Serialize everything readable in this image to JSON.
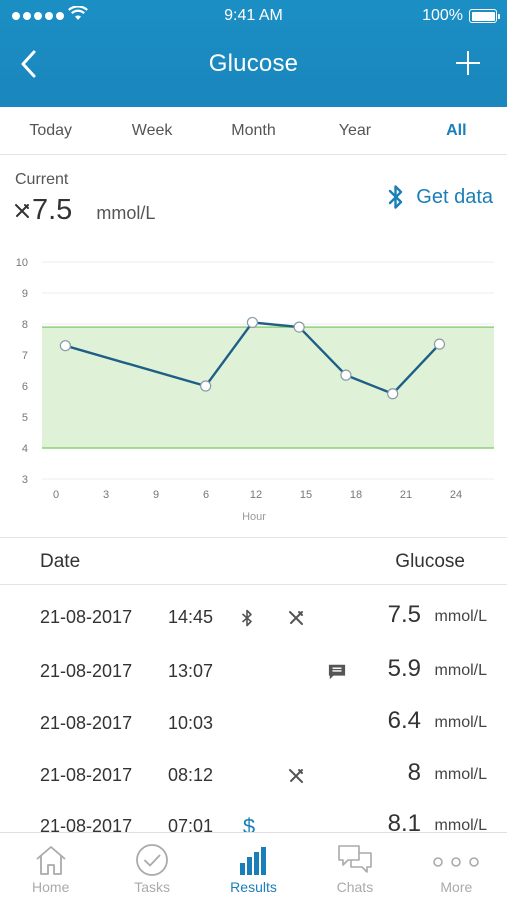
{
  "status_bar": {
    "time": "9:41 AM",
    "battery": "100%"
  },
  "nav": {
    "title": "Glucose"
  },
  "tabs": [
    {
      "label": "Today",
      "active": false
    },
    {
      "label": "Week",
      "active": false
    },
    {
      "label": "Month",
      "active": false
    },
    {
      "label": "Year",
      "active": false
    },
    {
      "label": "All",
      "active": true
    }
  ],
  "current": {
    "label": "Current",
    "value": "7.5",
    "unit": "mmol/L",
    "icon": "fork-knife-icon"
  },
  "get_data": {
    "label": "Get data",
    "icon": "bluetooth-icon"
  },
  "chart_data": {
    "type": "line",
    "xlabel": "Hour",
    "ylabel": "",
    "xlim": [
      -1.5,
      27.5
    ],
    "ylim": [
      3,
      10
    ],
    "x_ticks": [
      0,
      3,
      9,
      6,
      12,
      15,
      18,
      21,
      24
    ],
    "y_ticks": [
      10,
      9,
      8,
      7,
      6,
      5,
      4,
      3
    ],
    "target_range": [
      4,
      7.9
    ],
    "series": [
      {
        "x": [
          0,
          9,
          12,
          15,
          18,
          21,
          24
        ],
        "values": [
          7.3,
          6.0,
          8.05,
          7.9,
          6.35,
          5.75,
          7.35
        ]
      }
    ],
    "grid": true,
    "colors": {
      "line": "#1f5f87",
      "band": "#dff2d8",
      "band_border": "#8fd07c"
    }
  },
  "table": {
    "header": {
      "date": "Date",
      "glucose": "Glucose"
    },
    "rows": [
      {
        "date": "21-08-2017",
        "time": "14:45",
        "icons": [
          "bluetooth-icon",
          "fork-knife-icon"
        ],
        "value": "7.5",
        "unit": "mmol/L"
      },
      {
        "date": "21-08-2017",
        "time": "13:07",
        "icons": [
          "comment-icon"
        ],
        "value": "5.9",
        "unit": "mmol/L"
      },
      {
        "date": "21-08-2017",
        "time": "10:03",
        "icons": [],
        "value": "6.4",
        "unit": "mmol/L"
      },
      {
        "date": "21-08-2017",
        "time": "08:12",
        "icons": [
          "fork-knife-icon"
        ],
        "value": "8",
        "unit": "mmol/L"
      },
      {
        "date": "21-08-2017",
        "time": "07:01",
        "icons": [
          "dollar-icon"
        ],
        "value": "8.1",
        "unit": "mmol/L"
      }
    ]
  },
  "tabbar": [
    {
      "label": "Home",
      "icon": "home-icon",
      "active": false
    },
    {
      "label": "Tasks",
      "icon": "check-circle-icon",
      "active": false
    },
    {
      "label": "Results",
      "icon": "bar-chart-icon",
      "active": true
    },
    {
      "label": "Chats",
      "icon": "chat-bubbles-icon",
      "active": false
    },
    {
      "label": "More",
      "icon": "more-dots-icon",
      "active": false
    }
  ],
  "colors": {
    "accent": "#1a7fb8",
    "header": "#1b8fc4"
  }
}
